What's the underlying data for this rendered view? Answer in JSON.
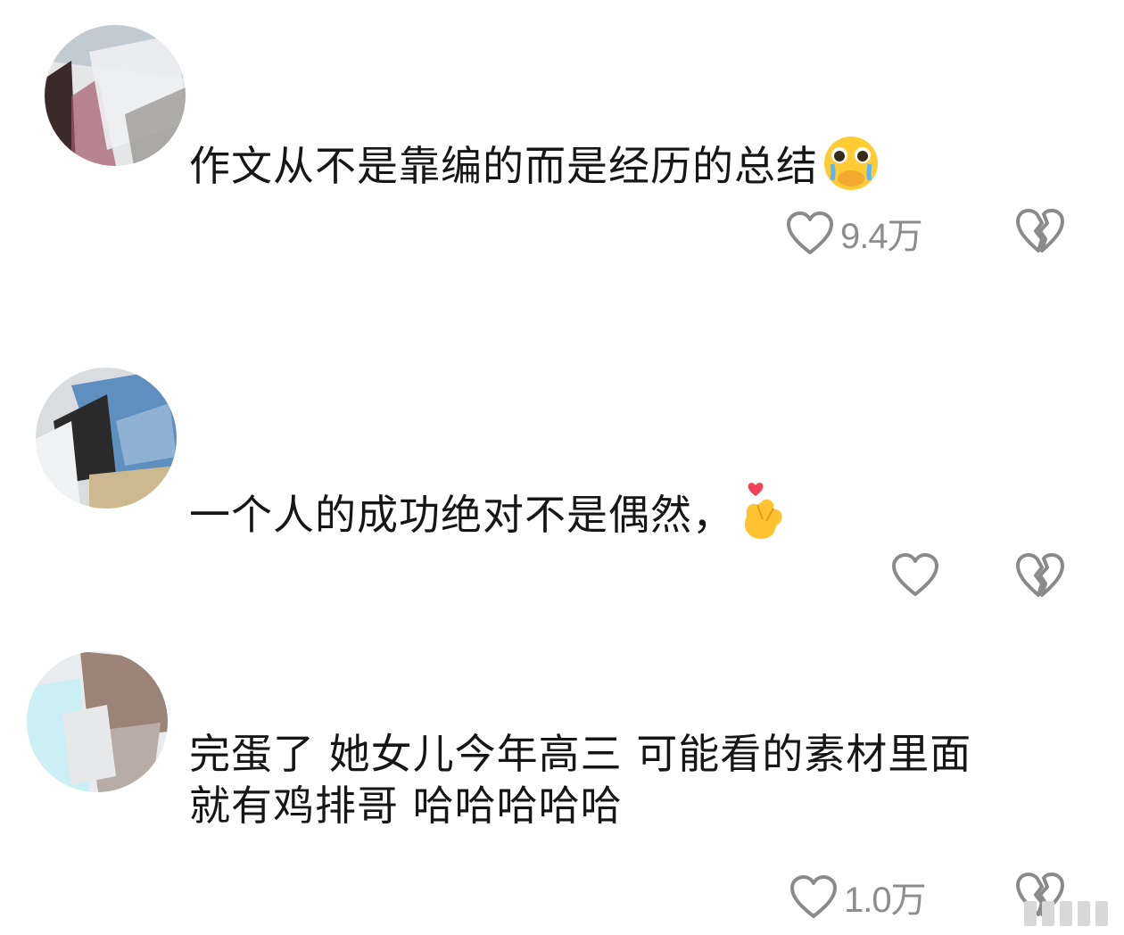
{
  "comments": [
    {
      "text": "作文从不是靠编的而是经历的总结",
      "emoji_icon": "crying-covering-mouth-emoji",
      "like_count": "9.4万"
    },
    {
      "text": "一个人的成功绝对不是偶然，",
      "emoji_icon": "finger-heart-emoji",
      "like_count": ""
    },
    {
      "text_lines": [
        "完蛋了 她女儿今年高三 可能看的素材里面",
        "就有鸡排哥 哈哈哈哈哈"
      ],
      "like_count": "1.0万"
    }
  ],
  "icons": {
    "like": "heart-outline-icon",
    "dislike": "broken-heart-icon"
  },
  "colors": {
    "text": "#161616",
    "icon_gray": "#8a8a8a",
    "background": "#ffffff"
  }
}
